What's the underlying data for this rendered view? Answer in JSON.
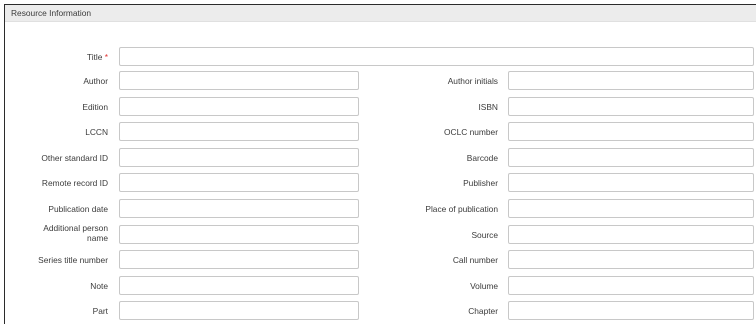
{
  "section": {
    "title": "Resource Information"
  },
  "title_field": {
    "label": "Title",
    "required_mark": "*",
    "value": ""
  },
  "rows": [
    {
      "left": {
        "label": "Author",
        "value": ""
      },
      "right": {
        "label": "Author initials",
        "value": ""
      }
    },
    {
      "left": {
        "label": "Edition",
        "value": ""
      },
      "right": {
        "label": "ISBN",
        "value": ""
      }
    },
    {
      "left": {
        "label": "LCCN",
        "value": ""
      },
      "right": {
        "label": "OCLC number",
        "value": ""
      }
    },
    {
      "left": {
        "label": "Other standard ID",
        "value": ""
      },
      "right": {
        "label": "Barcode",
        "value": ""
      }
    },
    {
      "left": {
        "label": "Remote record ID",
        "value": ""
      },
      "right": {
        "label": "Publisher",
        "value": ""
      }
    },
    {
      "left": {
        "label": "Publication date",
        "value": ""
      },
      "right": {
        "label": "Place of publication",
        "value": ""
      }
    },
    {
      "left": {
        "label_line1": "Additional person",
        "label_line2": "name",
        "value": ""
      },
      "right": {
        "label": "Source",
        "value": ""
      }
    },
    {
      "left": {
        "label": "Series title number",
        "value": ""
      },
      "right": {
        "label": "Call number",
        "value": ""
      }
    },
    {
      "left": {
        "label": "Note",
        "value": ""
      },
      "right": {
        "label": "Volume",
        "value": ""
      }
    },
    {
      "left": {
        "label": "Part",
        "value": ""
      },
      "right": {
        "label": "Chapter",
        "value": ""
      }
    }
  ]
}
